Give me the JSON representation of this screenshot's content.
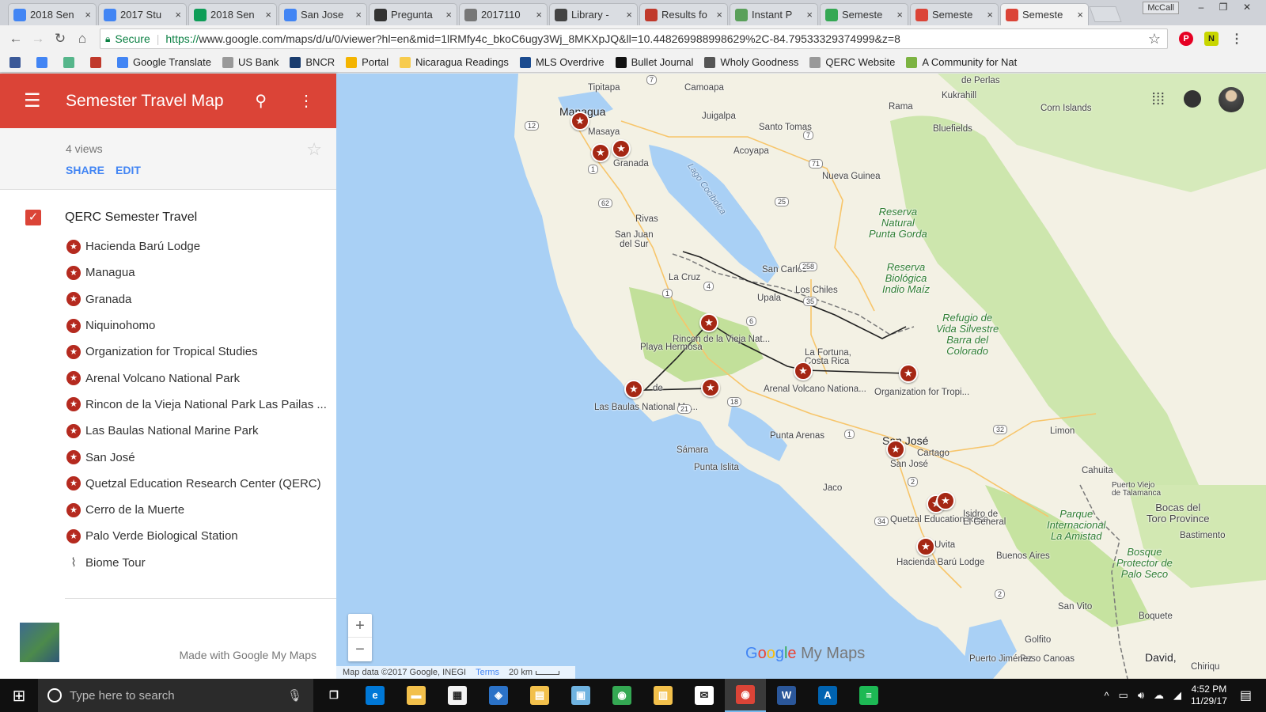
{
  "browser": {
    "tabs": [
      {
        "label": "2018 Sen",
        "color": "#4285f4",
        "icon": "drive-icon"
      },
      {
        "label": "2017 Stu",
        "color": "#4285f4",
        "icon": "docs-icon"
      },
      {
        "label": "2018 Sen",
        "color": "#0f9d58",
        "icon": "sheets-icon"
      },
      {
        "label": "San Jose",
        "color": "#4285f4",
        "icon": "docs-icon"
      },
      {
        "label": "Pregunta",
        "color": "#333333",
        "icon": "globe-icon"
      },
      {
        "label": "2017110",
        "color": "#777777",
        "icon": "file-icon"
      },
      {
        "label": "Library -",
        "color": "#444444",
        "icon": "library-icon"
      },
      {
        "label": "Results fo",
        "color": "#c0392b",
        "icon": "results-icon"
      },
      {
        "label": "Instant P",
        "color": "#5aa05a",
        "icon": "instant-icon"
      },
      {
        "label": "Semeste",
        "color": "#34a853",
        "icon": "maps-icon"
      },
      {
        "label": "Semeste",
        "color": "#db4437",
        "icon": "mymaps-icon"
      },
      {
        "label": "Semeste",
        "color": "#db4437",
        "icon": "mymaps-icon"
      }
    ],
    "active_tab": 11,
    "close_glyph": "×",
    "window_user": "McCall",
    "secure_label": "Secure",
    "url_scheme": "https://",
    "url_rest": "www.google.com/maps/d/u/0/viewer?hl=en&mid=1lRMfy4c_bkoC6ugy3Wj_8MKXpJQ&ll=10.448269988998629%2C-84.79533329374999&z=8",
    "bookmarks": [
      {
        "label": "",
        "icon": "facebook-icon",
        "color": "#3b5998"
      },
      {
        "label": "",
        "icon": "google-icon",
        "color": "#4285f4"
      },
      {
        "label": "",
        "icon": "slack-icon",
        "color": "#56b68b"
      },
      {
        "label": "",
        "icon": "wf-icon",
        "color": "#c0392b"
      },
      {
        "label": "Google Translate",
        "icon": "translate-icon",
        "color": "#4285f4"
      },
      {
        "label": "US Bank",
        "icon": "page-icon",
        "color": "#999999"
      },
      {
        "label": "BNCR",
        "icon": "bn-icon",
        "color": "#1a3c6e"
      },
      {
        "label": "Portal",
        "icon": "portal-icon",
        "color": "#f4b400"
      },
      {
        "label": "Nicaragua Readings",
        "icon": "folder-icon",
        "color": "#f7cb4d"
      },
      {
        "label": "MLS Overdrive",
        "icon": "overdrive-icon",
        "color": "#1b4b8f"
      },
      {
        "label": "Bullet Journal",
        "icon": "journal-icon",
        "color": "#111111"
      },
      {
        "label": "Wholy Goodness",
        "icon": "wg-icon",
        "color": "#555555"
      },
      {
        "label": "QERC Website",
        "icon": "page-icon",
        "color": "#999999"
      },
      {
        "label": "A Community for Nat",
        "icon": "leaf-icon",
        "color": "#7cb342"
      }
    ]
  },
  "panel": {
    "title": "Semester Travel Map",
    "views": "4 views",
    "share_label": "SHARE",
    "edit_label": "EDIT",
    "layer_name": "QERC Semester Travel",
    "places": [
      "Hacienda Barú Lodge",
      "Managua",
      "Granada",
      "Niquinohomo",
      "Organization for Tropical Studies",
      "Arenal Volcano National Park",
      "Rincon de la Vieja National Park Las Pailas ...",
      "Las Baulas National Marine Park",
      "San José",
      "Quetzal Education Research Center (QERC)",
      "Cerro de la Muerte",
      "Palo Verde Biological Station"
    ],
    "route_label": "Biome Tour",
    "made_with": "Made with Google My Maps"
  },
  "map": {
    "labels": {
      "tipitapa": "Tipitapa",
      "managua": "Managua",
      "masaya": "Masaya",
      "granada": "Granada",
      "juigalpa": "Juigalpa",
      "camoapa": "Camoapa",
      "santo_tomas": "Santo Tomas",
      "acoyapa": "Acoyapa",
      "nueva_guinea": "Nueva Guinea",
      "bluefields": "Bluefields",
      "rama": "Rama",
      "kukrahill": "Kukrahill",
      "perlas": "de Perlas",
      "corn_islands": "Corn Islands",
      "rivas": "Rivas",
      "san_juan": "San Juan\ndel Sur",
      "lago": "Lago Cocibolca",
      "reserva1": "Reserva\nNatural\nPunta Gorda",
      "reserva2": "Reserva\nBiológica\nIndio Maíz",
      "san_carlos": "San Carlos",
      "la_cruz": "La Cruz",
      "upala": "Upala",
      "los_chiles": "Los Chiles",
      "refugio": "Refugio de\nVida Silvestre\nBarra del\nColorado",
      "rincon": "Rincon de la Vieja Nat...",
      "playa": "Playa Hermosa",
      "la_fortuna": "La Fortuna,\nCosta Rica",
      "arenal": "Arenal Volcano Nationa...",
      "ots": "Organization for Tropi...",
      "las_baulas": "Las Baulas National Ma...",
      "tamarindo": "Tr",
      "tamarindo2": "de",
      "punta_arenas": "Punta Arenas",
      "samara": "Sámara",
      "punta_islita": "Punta Islita",
      "san_jose_big": "San José",
      "cartago": "Cartago",
      "san_jose": "San José",
      "limon": "Limon",
      "cahuita": "Cahuita",
      "puerto_viejo": "Puerto Viejo\nde Talamanca",
      "bocas": "Bocas del\nToro Province",
      "bastimento": "Bastimento",
      "parque": "Parque\nInternacional\nLa Amistad",
      "bosque": "Bosque\nProtector de\nPalo Seco",
      "jaco": "Jaco",
      "qerc": "Quetzal Education Rese...",
      "isidro": "Isidro de\nEl General",
      "uvita": "Uvita",
      "hacienda": "Hacienda Barú Lodge",
      "buenos_aires": "Buenos Aires",
      "san_vito": "San Vito",
      "boquete": "Boquete",
      "golfito": "Golfito",
      "paso_canoas": "Paso Canoas",
      "david": "David,",
      "puerto_jimenez": "Puerto Jiménez",
      "chiriqui": "Chiriqu"
    },
    "road_shields": [
      "7",
      "12",
      "1",
      "7",
      "71",
      "25",
      "62",
      "258",
      "4",
      "1",
      "6",
      "35",
      "18",
      "21",
      "1",
      "32",
      "2",
      "34",
      "2"
    ],
    "zoom_in": "+",
    "zoom_out": "−",
    "footer": {
      "data": "Map data ©2017 Google, INEGI",
      "terms": "Terms",
      "scale": "20 km"
    },
    "logo_suffix": "My Maps",
    "colors": {
      "land": "#f5f3e8",
      "green": "#c6e3a0",
      "water": "#a9d0f5",
      "marker": "#a52714",
      "route": "#222222",
      "accent": "#db4437"
    }
  },
  "taskbar": {
    "search_placeholder": "Type here to search",
    "apps": [
      {
        "icon": "task-view-icon",
        "color": "#101010",
        "glyph": "❐"
      },
      {
        "icon": "edge-icon",
        "color": "#0078d7",
        "glyph": "e"
      },
      {
        "icon": "file-explorer-icon",
        "color": "#f2c04b",
        "glyph": "▬"
      },
      {
        "icon": "store-icon",
        "color": "#f3f3f3",
        "glyph": "▦"
      },
      {
        "icon": "app5-icon",
        "color": "#2b72c7",
        "glyph": "◈"
      },
      {
        "icon": "files-icon",
        "color": "#f2c04b",
        "glyph": "▤"
      },
      {
        "icon": "app7-icon",
        "color": "#6fb3e0",
        "glyph": "▣"
      },
      {
        "icon": "chrome-icon",
        "color": "#34a853",
        "glyph": "◉"
      },
      {
        "icon": "app9-icon",
        "color": "#f2c04b",
        "glyph": "▥"
      },
      {
        "icon": "mail-icon",
        "color": "#ffffff",
        "glyph": "✉"
      },
      {
        "icon": "chrome2-icon",
        "color": "#db4437",
        "glyph": "◉"
      },
      {
        "icon": "word-icon",
        "color": "#2b579a",
        "glyph": "W"
      },
      {
        "icon": "app13-icon",
        "color": "#0063b1",
        "glyph": "A"
      },
      {
        "icon": "spotify-icon",
        "color": "#1db954",
        "glyph": "≡"
      }
    ],
    "active_app": 10,
    "time": "4:52 PM",
    "date": "11/29/17"
  }
}
